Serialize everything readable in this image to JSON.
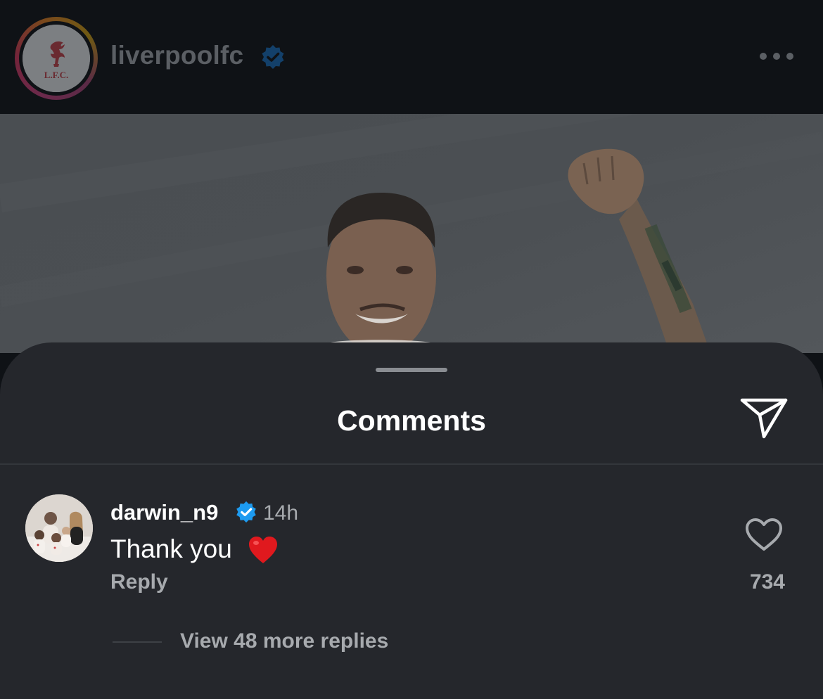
{
  "post": {
    "account": {
      "username": "liverpoolfc",
      "crest_text": "L.F.C.",
      "verified": true
    }
  },
  "comments_sheet": {
    "title": "Comments"
  },
  "comments": [
    {
      "username": "darwin_n9",
      "verified": true,
      "time": "14h",
      "text": "Thank you",
      "emoji": "red-heart",
      "reply_label": "Reply",
      "likes": "734",
      "view_replies_label": "View 48 more replies"
    }
  ],
  "colors": {
    "background": "#0f1216",
    "sheet": "#25272c",
    "text_primary": "#ffffff",
    "text_secondary": "#a7aaae",
    "verified_blue": "#1d9bf0",
    "heart_red": "#e0191e"
  },
  "icons": [
    "verified-badge-icon",
    "more-options-icon",
    "share-icon",
    "heart-outline-icon",
    "red-heart-emoji"
  ]
}
